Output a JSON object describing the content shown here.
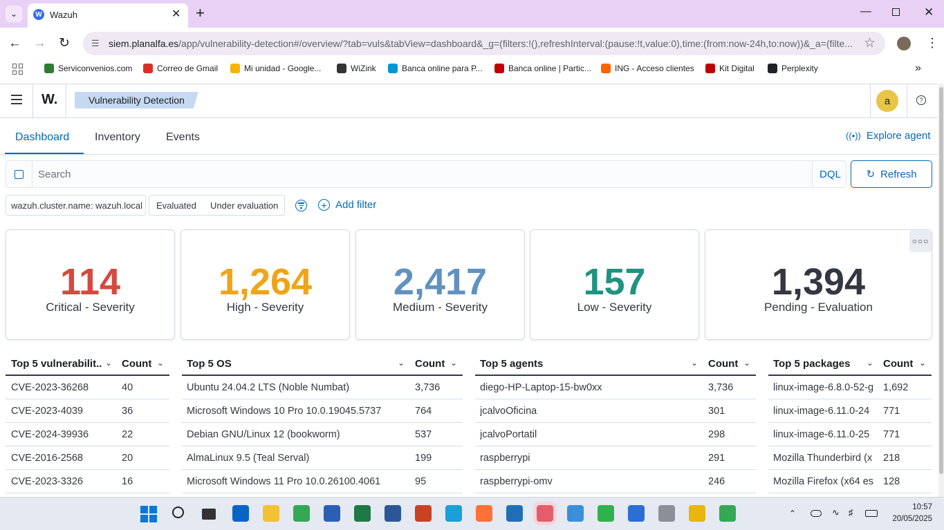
{
  "browser": {
    "tab_title": "Wazuh",
    "favicon_letter": "W",
    "url_host": "siem.planalfa.es",
    "url_rest": "/app/vulnerability-detection#/overview/?tab=vuls&tabView=dashboard&_g=(filters:!(),refreshInterval:(pause:!t,value:0),time:(from:now-24h,to:now))&_a=(filte...",
    "bookmarks": [
      {
        "label": "Serviconvenios.com",
        "color": "#2f7d32"
      },
      {
        "label": "Correo de Gmail",
        "color": "#d93025"
      },
      {
        "label": "Mi unidad - Google...",
        "color": "#f4b400"
      },
      {
        "label": "WiZink",
        "color": "#333333"
      },
      {
        "label": "Banca online para P...",
        "color": "#0096d6"
      },
      {
        "label": "Banca online | Partic...",
        "color": "#c00000"
      },
      {
        "label": "ING - Acceso clientes",
        "color": "#ff6200"
      },
      {
        "label": "Kit Digital",
        "color": "#c00000"
      },
      {
        "label": "Perplexity",
        "color": "#202124"
      }
    ]
  },
  "header": {
    "logo": "W.",
    "breadcrumb": "Vulnerability Detection",
    "avatar_letter": "a"
  },
  "tabs": {
    "dashboard": "Dashboard",
    "inventory": "Inventory",
    "events": "Events",
    "explore_agent": "Explore agent"
  },
  "search": {
    "placeholder": "Search",
    "language": "DQL",
    "refresh_label": "Refresh"
  },
  "filters": {
    "cluster_pill": "wazuh.cluster.name: wazuh.local",
    "evaluated": "Evaluated",
    "under_evaluation": "Under evaluation",
    "add_filter": "Add filter"
  },
  "stats": [
    {
      "value": "114",
      "label": "Critical - Severity",
      "color": "#d6493f"
    },
    {
      "value": "1,264",
      "label": "High - Severity",
      "color": "#f0a417"
    },
    {
      "value": "2,417",
      "label": "Medium - Severity",
      "color": "#6092c0"
    },
    {
      "value": "157",
      "label": "Low - Severity",
      "color": "#209280"
    },
    {
      "value": "1,394",
      "label": "Pending - Evaluation",
      "color": "#343741"
    }
  ],
  "tables": {
    "vulns": {
      "name_header": "Top 5 vulnerabilit...",
      "count_header": "Count",
      "rows": [
        {
          "name": "CVE-2023-36268",
          "count": "40"
        },
        {
          "name": "CVE-2023-4039",
          "count": "36"
        },
        {
          "name": "CVE-2024-39936",
          "count": "22"
        },
        {
          "name": "CVE-2016-2568",
          "count": "20"
        },
        {
          "name": "CVE-2023-3326",
          "count": "16"
        }
      ]
    },
    "os": {
      "name_header": "Top 5 OS",
      "count_header": "Count",
      "rows": [
        {
          "name": "Ubuntu 24.04.2 LTS (Noble Numbat)",
          "count": "3,736"
        },
        {
          "name": "Microsoft Windows 10 Pro 10.0.19045.5737",
          "count": "764"
        },
        {
          "name": "Debian GNU/Linux 12 (bookworm)",
          "count": "537"
        },
        {
          "name": "AlmaLinux 9.5 (Teal Serval)",
          "count": "199"
        },
        {
          "name": "Microsoft Windows 11 Pro 10.0.26100.4061",
          "count": "95"
        }
      ]
    },
    "agents": {
      "name_header": "Top 5 agents",
      "count_header": "Count",
      "rows": [
        {
          "name": "diego-HP-Laptop-15-bw0xx",
          "count": "3,736"
        },
        {
          "name": "jcalvoOficina",
          "count": "301"
        },
        {
          "name": "jcalvoPortatil",
          "count": "298"
        },
        {
          "name": "raspberrypi",
          "count": "291"
        },
        {
          "name": "raspberrypi-omv",
          "count": "246"
        }
      ]
    },
    "packages": {
      "name_header": "Top 5 packages",
      "count_header": "Count",
      "rows": [
        {
          "name": "linux-image-6.8.0-52-g",
          "count": "1,692"
        },
        {
          "name": "linux-image-6.11.0-24",
          "count": "771"
        },
        {
          "name": "linux-image-6.11.0-25",
          "count": "771"
        },
        {
          "name": "Mozilla Thunderbird (x",
          "count": "218"
        },
        {
          "name": "Mozilla Firefox (x64 es",
          "count": "128"
        }
      ]
    }
  },
  "taskbar": {
    "time": "10:57",
    "date": "20/05/2025",
    "icons": [
      {
        "name": "outlook",
        "color": "#0a64c8"
      },
      {
        "name": "explorer",
        "color": "#f2c232"
      },
      {
        "name": "chrome",
        "color": "#34a853"
      },
      {
        "name": "app",
        "color": "#2b5fb3"
      },
      {
        "name": "excel",
        "color": "#1d7a45"
      },
      {
        "name": "word",
        "color": "#2b5797"
      },
      {
        "name": "powerpoint",
        "color": "#c84323"
      },
      {
        "name": "edge",
        "color": "#1b9fd8"
      },
      {
        "name": "firefox",
        "color": "#ff7139"
      },
      {
        "name": "app2",
        "color": "#1f6fb5"
      },
      {
        "name": "snipping",
        "color": "#e35d6a"
      },
      {
        "name": "notepad",
        "color": "#3a8fd8"
      },
      {
        "name": "app3",
        "color": "#2fb24c"
      },
      {
        "name": "app4",
        "color": "#2b6fd6"
      },
      {
        "name": "database",
        "color": "#8a8f99"
      },
      {
        "name": "powerbi",
        "color": "#e8b60c"
      },
      {
        "name": "chrome-profile",
        "color": "#34a853"
      }
    ]
  }
}
